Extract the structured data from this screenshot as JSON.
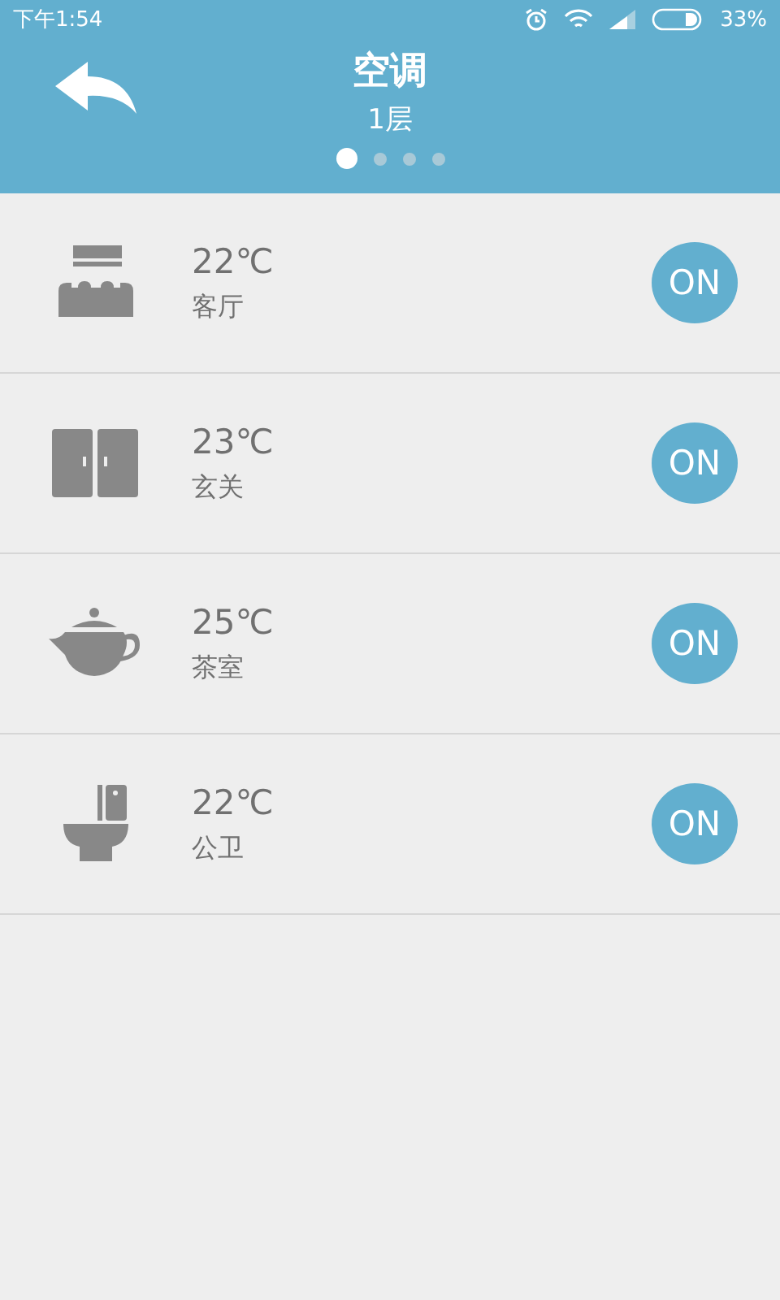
{
  "status_bar": {
    "time": "下午1:54",
    "battery": "33%"
  },
  "header": {
    "title": "空调",
    "subtitle": "1层"
  },
  "pages": [
    {
      "selected": true
    },
    {
      "selected": false
    },
    {
      "selected": false
    },
    {
      "selected": false
    }
  ],
  "rooms": [
    {
      "kind": "sofa",
      "temperature": "22℃",
      "name": "客厅",
      "power": "ON",
      "on": true
    },
    {
      "kind": "wardrobe",
      "temperature": "23℃",
      "name": "玄关",
      "power": "ON",
      "on": true
    },
    {
      "kind": "teapot",
      "temperature": "25℃",
      "name": "茶室",
      "power": "ON",
      "on": true
    },
    {
      "kind": "toilet",
      "temperature": "22℃",
      "name": "公卫",
      "power": "ON",
      "on": true
    }
  ]
}
